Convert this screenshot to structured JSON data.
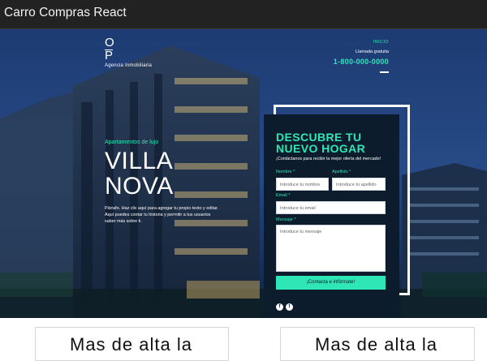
{
  "window": {
    "title": "Carro Compras React"
  },
  "brand": {
    "mark_top": "O",
    "mark_bottom": "P",
    "name": "Agencia Inmobiliaria"
  },
  "nav": {
    "home": "INICIO",
    "free_call": "Llamada gratuita",
    "phone": "1-800-000-0000"
  },
  "hero": {
    "kicker": "Apartamentos de lujo",
    "title_line1": "VILLA",
    "title_line2": "NOVA",
    "paragraph": "Párrafo. Haz clic aquí para agregar tu propio texto y editar. Aquí puedes contar tu historia y permitir a tus usuarios saber más sobre ti."
  },
  "form": {
    "title_line1": "DESCUBRE TU",
    "title_line2": "NUEVO HOGAR",
    "subtitle": "¡Contáctanos para recibir la mejor oferta del mercado!",
    "name_label": "Nombre",
    "surname_label": "Apellido",
    "email_label": "Email",
    "message_label": "Mensaje",
    "required_mark": "*",
    "name_placeholder": "Introduce tu nombre",
    "surname_placeholder": "Introduce tu apellido",
    "email_placeholder": "Introduce tu email",
    "message_placeholder": "Introduce tu mensaje",
    "submit_label": "¡Contacta e infórmate!",
    "social": {
      "facebook_glyph": "f",
      "twitter_glyph": "t"
    }
  },
  "cards": [
    {
      "title": "Mas de alta la"
    },
    {
      "title": "Mas de alta la"
    }
  ],
  "colors": {
    "accent": "#2ee6b6",
    "card_bg": "#0c1c2c",
    "topbar": "#222222"
  }
}
